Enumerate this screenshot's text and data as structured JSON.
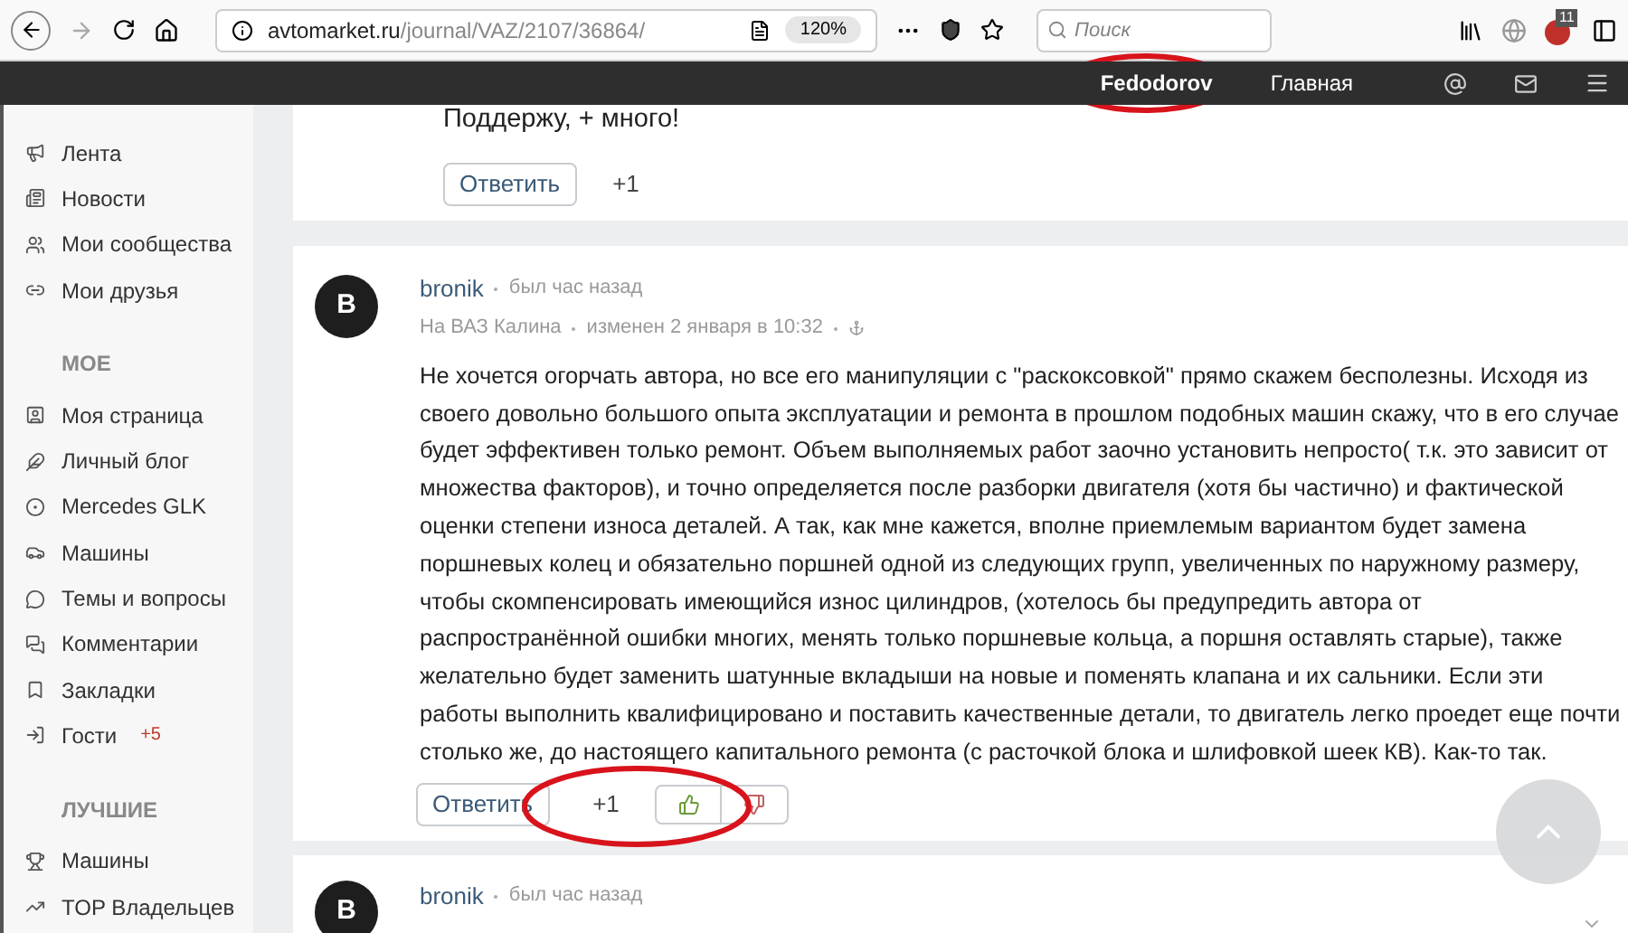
{
  "browser": {
    "url_host": "avtomarket.ru",
    "url_path": "/journal/VAZ/2107/36864/",
    "zoom": "120%",
    "search_placeholder": "Поиск",
    "extension_badge": "11"
  },
  "header": {
    "user": "Fedodorov",
    "nav_link": "Главная"
  },
  "sidebar": [
    {
      "items": [
        {
          "label": "Лента"
        },
        {
          "label": "Новости"
        },
        {
          "label": "Мои сообщества"
        },
        {
          "label": "Мои друзья"
        }
      ]
    },
    {
      "heading": "МОЕ",
      "items": [
        {
          "label": "Моя страница"
        },
        {
          "label": "Личный блог"
        },
        {
          "label": "Mercedes GLK"
        },
        {
          "label": "Машины"
        },
        {
          "label": "Темы и вопросы"
        },
        {
          "label": "Комментарии"
        },
        {
          "label": "Закладки"
        },
        {
          "label": "Гости",
          "badge": "+5"
        }
      ]
    },
    {
      "heading": "ЛУЧШИЕ",
      "items": [
        {
          "label": "Машины"
        },
        {
          "label": "TOP Владельцев"
        }
      ]
    }
  ],
  "posts": [
    {
      "kind": "partial",
      "text": "Поддержу, + много!",
      "reply": "Ответить",
      "score": "+1"
    },
    {
      "kind": "full",
      "author": "bronik",
      "avatar": "B",
      "status": "был час назад",
      "car": "На ВАЗ Калина",
      "edited": "изменен 2 января в 10:32",
      "text": "Не хочется огорчать автора, но все его манипуляции с \"раскоксовкой\" прямо скажем бесполезны. Исходя из своего довольно большого опыта эксплуатации и ремонта в прошлом подобных машин скажу, что в его случае будет эффективен только ремонт. Объем выполняемых работ заочно установить непросто( т.к. это зависит от множества факторов), и точно определяется после разборки двигателя (хотя бы частично) и фактической оценки степени износа деталей. А так, как мне кажется, вполне приемлемым вариантом будет замена поршневых колец и обязательно поршней одной из следующих групп, увеличенных по наружному размеру, чтобы скомпенсировать имеющийся износ цилиндров, (хотелось бы предупредить автора от распространённой ошибки многих, менять только поршневые кольца, а поршня оставлять старые), также желательно будет заменить шатунные вкладыши на новые и поменять клапана и их сальники. Если эти работы выполнить квалифицировано и поставить качественные детали, то двигатель легко проедет еще почти столько же, до настоящего капитального ремонта (с расточкой блока и шлифовкой шеек КВ). Как-то так.",
      "reply": "Ответить",
      "score": "+1"
    },
    {
      "kind": "header",
      "author": "bronik",
      "avatar": "B",
      "status": "был час назад"
    }
  ]
}
